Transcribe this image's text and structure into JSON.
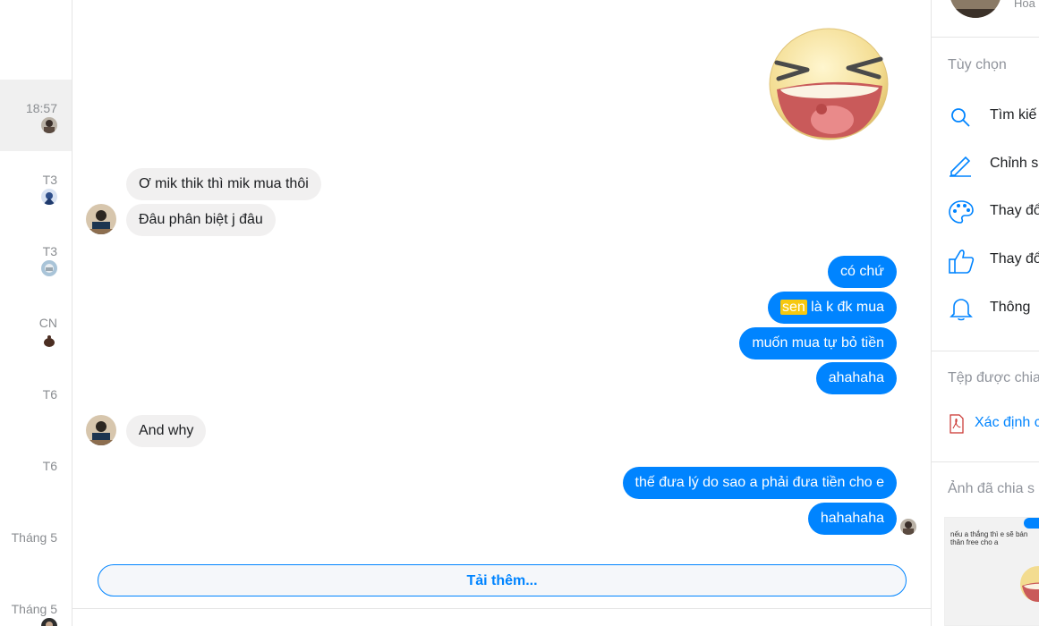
{
  "conversation_list": {
    "items": [
      {
        "time": "18:57",
        "active": true
      },
      {
        "time": "T3"
      },
      {
        "time": "T3"
      },
      {
        "time": "CN"
      },
      {
        "time": "T6"
      },
      {
        "time": "T6"
      },
      {
        "time": "Tháng 5"
      },
      {
        "time": "Tháng 5"
      }
    ]
  },
  "chat": {
    "messages": [
      {
        "from": "them",
        "text": "Ơ mik thik thì mik mua thôi"
      },
      {
        "from": "them",
        "text": "Đâu phân biệt j đâu"
      },
      {
        "from": "me",
        "text": "có chứ"
      },
      {
        "from": "me",
        "highlight": "sen",
        "text": " là k đk mua"
      },
      {
        "from": "me",
        "text": "muốn mua tự bỏ tiền"
      },
      {
        "from": "me",
        "text": "ahahaha"
      },
      {
        "from": "them",
        "text": "And why"
      },
      {
        "from": "me",
        "text": "thế đưa lý do sao a phải đưa tiền cho e"
      },
      {
        "from": "me",
        "text": "hahahaha"
      }
    ],
    "load_more_label": "Tải thêm..."
  },
  "right_panel": {
    "top_name": "Hoa",
    "options_title": "Tùy chọn",
    "options": [
      {
        "icon": "search-icon",
        "label": "Tìm kiế"
      },
      {
        "icon": "pencil-icon",
        "label": "Chỉnh s"
      },
      {
        "icon": "palette-icon",
        "label": "Thay đổ"
      },
      {
        "icon": "thumbs-up-icon",
        "label": "Thay đổ"
      },
      {
        "icon": "bell-icon",
        "label": "Thông"
      }
    ],
    "files_title": "Tệp được chia",
    "file_name": "Xác định c",
    "photos_title": "Ảnh đã chia s",
    "photo_caption": "nếu a thắng thì e sẽ bán thân free cho a"
  },
  "colors": {
    "accent": "#0084ff",
    "incoming_bubble": "#f1f0f0",
    "highlight": "#f6c80f"
  }
}
